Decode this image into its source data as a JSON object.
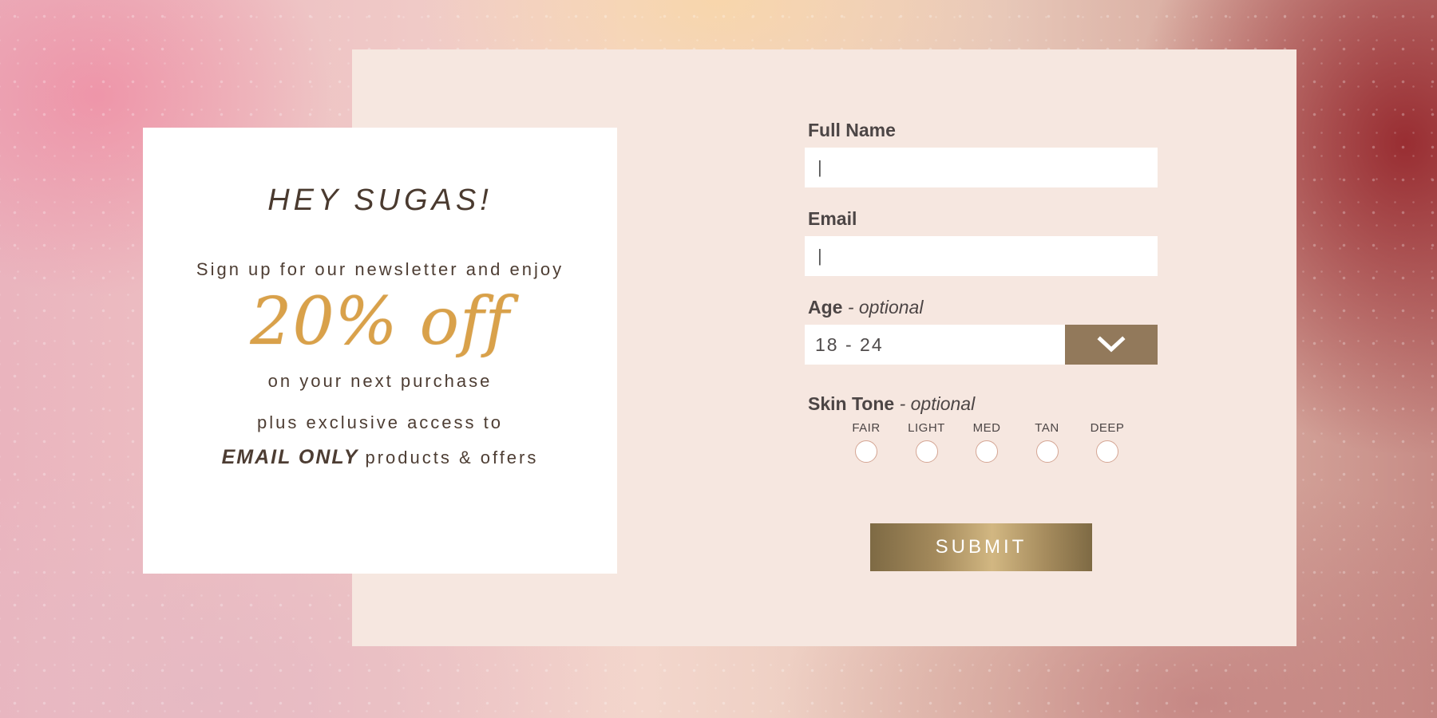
{
  "promo": {
    "title": "HEY SUGAS!",
    "line1": "Sign up for our newsletter and enjoy",
    "discount": "20% off",
    "line2": "on your next purchase",
    "line3": "plus exclusive access to",
    "line4_emphasis": "EMAIL ONLY",
    "line4_rest": "products & offers"
  },
  "form": {
    "full_name": {
      "label": "Full Name",
      "value": "|"
    },
    "email": {
      "label": "Email",
      "value": "|"
    },
    "age": {
      "label": "Age",
      "optional": "- optional",
      "selected": "18 - 24"
    },
    "skin_tone": {
      "label": "Skin Tone",
      "optional": "- optional",
      "options": [
        "FAIR",
        "LIGHT",
        "MED",
        "TAN",
        "DEEP"
      ]
    },
    "submit_label": "SUBMIT"
  },
  "colors": {
    "panel": "#f6e7e0",
    "accent_brown": "#92795b",
    "gold_text": "#d9a14a",
    "heading_text": "#4a3a2f"
  },
  "icons": {
    "age_dropdown": "chevron-down-icon"
  }
}
